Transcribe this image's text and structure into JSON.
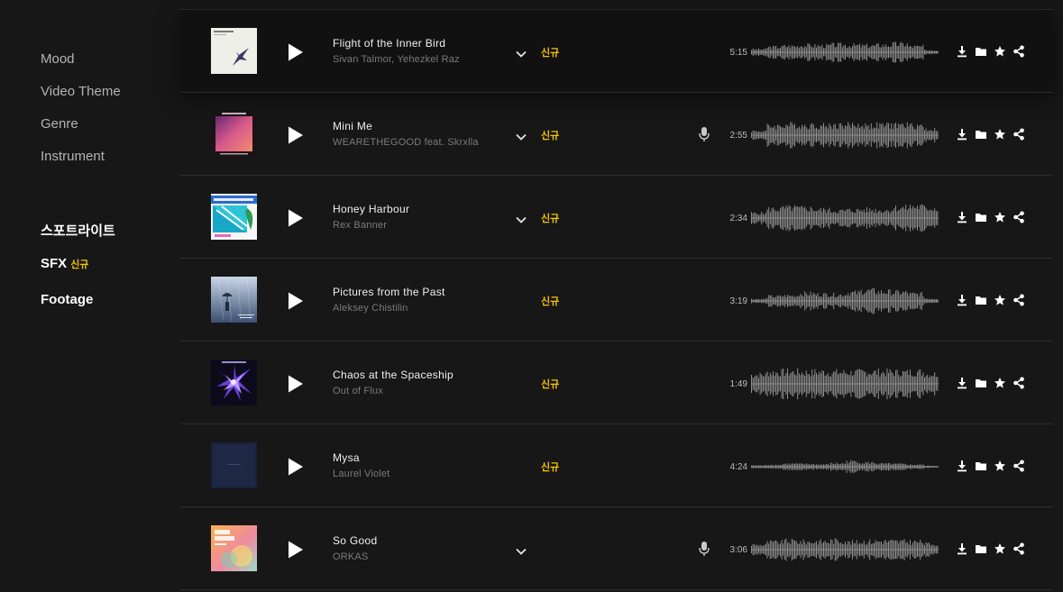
{
  "sidebar": {
    "categories": [
      {
        "label": "Mood"
      },
      {
        "label": "Video Theme"
      },
      {
        "label": "Genre"
      },
      {
        "label": "Instrument"
      }
    ],
    "extras": [
      {
        "label": "스포트라이트"
      },
      {
        "label": "SFX",
        "badge": "신규"
      },
      {
        "label": "Footage"
      }
    ]
  },
  "tracks": [
    {
      "title": "Flight of the Inner Bird",
      "artist": "Sivan Talmor, Yehezkel Raz",
      "badge": "신규",
      "duration": "5:15",
      "expandable": true,
      "vocals": false,
      "cover": "white-bird"
    },
    {
      "title": "Mini Me",
      "artist": "WEARETHEGOOD feat. Skrxlla",
      "badge": "신규",
      "duration": "2:55",
      "expandable": true,
      "vocals": true,
      "cover": "pink-gradient"
    },
    {
      "title": "Honey Harbour",
      "artist": "Rex Banner",
      "badge": "신규",
      "duration": "2:34",
      "expandable": true,
      "vocals": false,
      "cover": "tropical-house"
    },
    {
      "title": "Pictures from the Past",
      "artist": "Aleksey Chistilin",
      "badge": "신규",
      "duration": "3:19",
      "expandable": false,
      "vocals": false,
      "cover": "rain-umbrella"
    },
    {
      "title": "Chaos at the Spaceship",
      "artist": "Out of Flux",
      "badge": "신규",
      "duration": "1:49",
      "expandable": false,
      "vocals": false,
      "cover": "purple-shatter"
    },
    {
      "title": "Mysa",
      "artist": "Laurel Violet",
      "badge": "신규",
      "duration": "4:24",
      "expandable": false,
      "vocals": false,
      "cover": "dark-navy"
    },
    {
      "title": "So Good",
      "artist": "ORKAS",
      "badge": "",
      "duration": "3:06",
      "expandable": true,
      "vocals": true,
      "cover": "so-good-pastel"
    }
  ],
  "icons": {
    "play": "play-icon",
    "expand": "chevron-down-icon",
    "vocals": "microphone-icon",
    "download": "download-icon",
    "folder": "folder-icon",
    "favorite": "star-icon",
    "share": "share-icon"
  },
  "colors": {
    "background": "#171717",
    "highlight_row": "#111111",
    "accent_new": "#f5c400",
    "waveform": "#8e8e8e",
    "sidebar_text": "#b4b4b4"
  }
}
